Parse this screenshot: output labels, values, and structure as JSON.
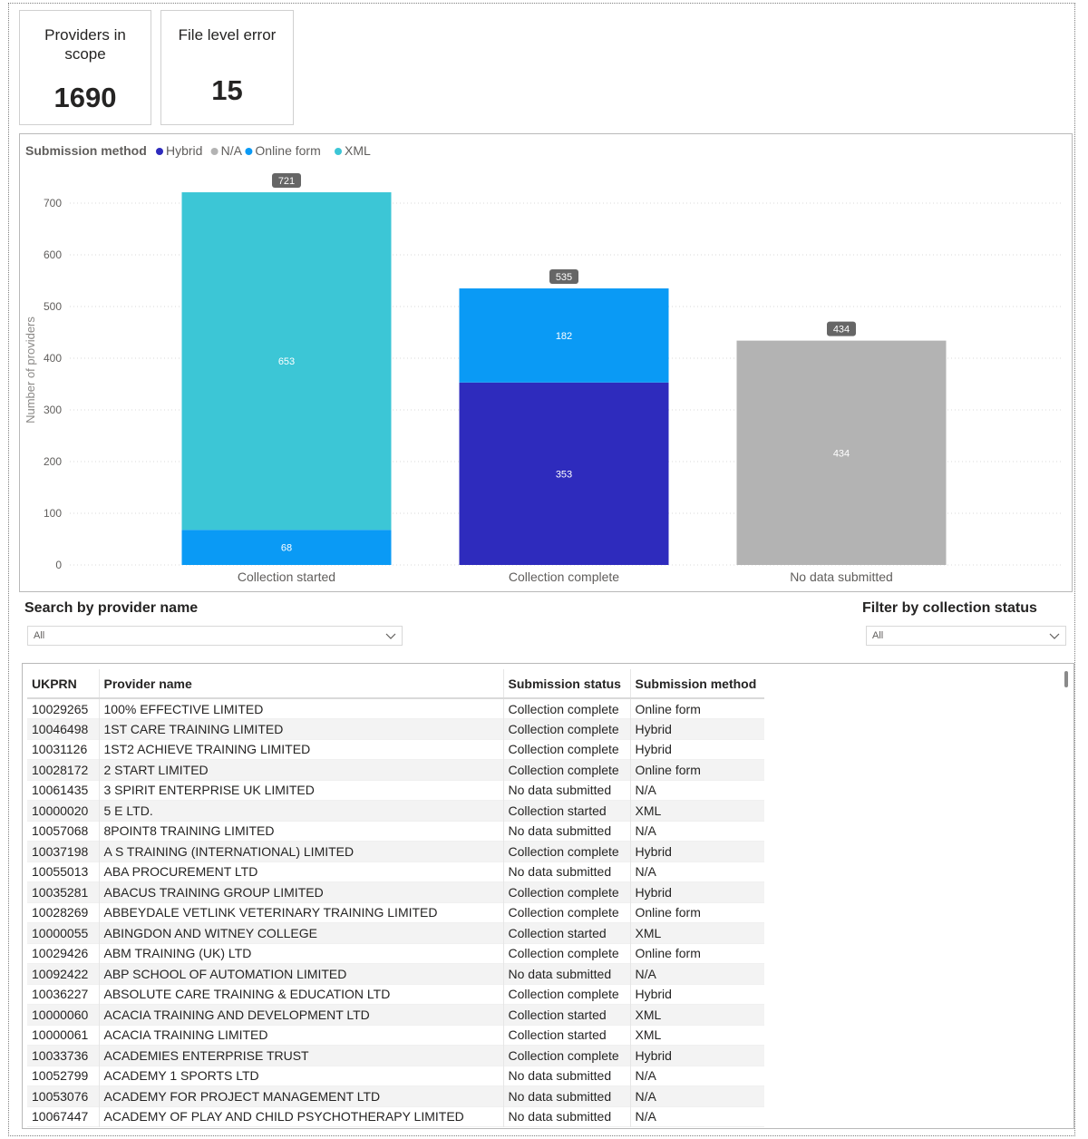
{
  "kpis": {
    "providers_in_scope": {
      "title": "Providers in scope",
      "value": "1690"
    },
    "file_level_error": {
      "title": "File level error",
      "value": "15"
    }
  },
  "colors": {
    "Hybrid": "#2e2bbd",
    "N/A": "#b3b3b3",
    "Online form": "#0a9af5",
    "XML": "#3cc6d6"
  },
  "chart_data": {
    "type": "bar",
    "stacked": true,
    "legend_title": "Submission method",
    "legend_placement": "top-left",
    "ylabel": "Number of providers",
    "ylim": [
      0,
      720
    ],
    "yticks": [
      0,
      100,
      200,
      300,
      400,
      500,
      600,
      700
    ],
    "categories": [
      "Collection started",
      "Collection complete",
      "No data submitted"
    ],
    "totals": [
      721,
      535,
      434
    ],
    "series": [
      {
        "name": "Hybrid",
        "values": [
          0,
          353,
          0
        ]
      },
      {
        "name": "N/A",
        "values": [
          0,
          0,
          434
        ]
      },
      {
        "name": "Online form",
        "values": [
          68,
          182,
          0
        ]
      },
      {
        "name": "XML",
        "values": [
          653,
          0,
          0
        ]
      }
    ]
  },
  "slicers": {
    "provider": {
      "title": "Search by provider name",
      "value": "All"
    },
    "status": {
      "title": "Filter by collection status",
      "value": "All"
    }
  },
  "table": {
    "columns": [
      "UKPRN",
      "Provider name",
      "Submission status",
      "Submission method"
    ],
    "rows": [
      [
        "10029265",
        "100% EFFECTIVE LIMITED",
        "Collection complete",
        "Online form"
      ],
      [
        "10046498",
        "1ST CARE TRAINING LIMITED",
        "Collection complete",
        "Hybrid"
      ],
      [
        "10031126",
        "1ST2 ACHIEVE TRAINING LIMITED",
        "Collection complete",
        "Hybrid"
      ],
      [
        "10028172",
        "2 START LIMITED",
        "Collection complete",
        "Online form"
      ],
      [
        "10061435",
        "3 SPIRIT ENTERPRISE UK LIMITED",
        "No data submitted",
        "N/A"
      ],
      [
        "10000020",
        "5 E LTD.",
        "Collection started",
        "XML"
      ],
      [
        "10057068",
        "8POINT8 TRAINING LIMITED",
        "No data submitted",
        "N/A"
      ],
      [
        "10037198",
        "A S TRAINING (INTERNATIONAL) LIMITED",
        "Collection complete",
        "Hybrid"
      ],
      [
        "10055013",
        "ABA PROCUREMENT LTD",
        "No data submitted",
        "N/A"
      ],
      [
        "10035281",
        "ABACUS TRAINING GROUP LIMITED",
        "Collection complete",
        "Hybrid"
      ],
      [
        "10028269",
        "ABBEYDALE VETLINK VETERINARY TRAINING LIMITED",
        "Collection complete",
        "Online form"
      ],
      [
        "10000055",
        "ABINGDON AND WITNEY COLLEGE",
        "Collection started",
        "XML"
      ],
      [
        "10029426",
        "ABM TRAINING (UK) LTD",
        "Collection complete",
        "Online form"
      ],
      [
        "10092422",
        "ABP SCHOOL OF AUTOMATION LIMITED",
        "No data submitted",
        "N/A"
      ],
      [
        "10036227",
        "ABSOLUTE CARE TRAINING & EDUCATION LTD",
        "Collection complete",
        "Hybrid"
      ],
      [
        "10000060",
        "ACACIA TRAINING AND DEVELOPMENT LTD",
        "Collection started",
        "XML"
      ],
      [
        "10000061",
        "ACACIA TRAINING LIMITED",
        "Collection started",
        "XML"
      ],
      [
        "10033736",
        "ACADEMIES ENTERPRISE TRUST",
        "Collection complete",
        "Hybrid"
      ],
      [
        "10052799",
        "ACADEMY 1 SPORTS LTD",
        "No data submitted",
        "N/A"
      ],
      [
        "10053076",
        "ACADEMY FOR PROJECT MANAGEMENT LTD",
        "No data submitted",
        "N/A"
      ],
      [
        "10067447",
        "ACADEMY OF PLAY AND CHILD PSYCHOTHERAPY LIMITED",
        "No data submitted",
        "N/A"
      ]
    ]
  }
}
